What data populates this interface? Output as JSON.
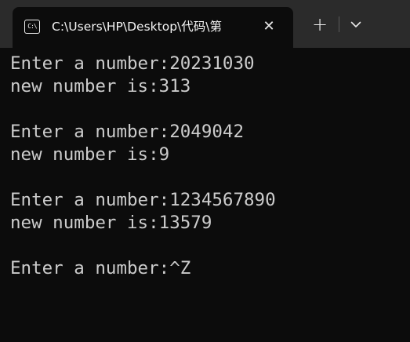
{
  "tab": {
    "icon_glyph": "C:\\",
    "title": "C:\\Users\\HP\\Desktop\\代码\\第",
    "close_glyph": "✕"
  },
  "toolbar": {
    "new_tab_glyph": "+"
  },
  "terminal": {
    "lines": [
      "Enter a number:20231030",
      "new number is:313",
      "",
      "Enter a number:2049042",
      "new number is:9",
      "",
      "Enter a number:1234567890",
      "new number is:13579",
      "",
      "Enter a number:^Z"
    ]
  },
  "colors": {
    "titlebar_bg": "#2b2b2b",
    "terminal_bg": "#0c0c0c",
    "terminal_text": "#cccccc"
  }
}
